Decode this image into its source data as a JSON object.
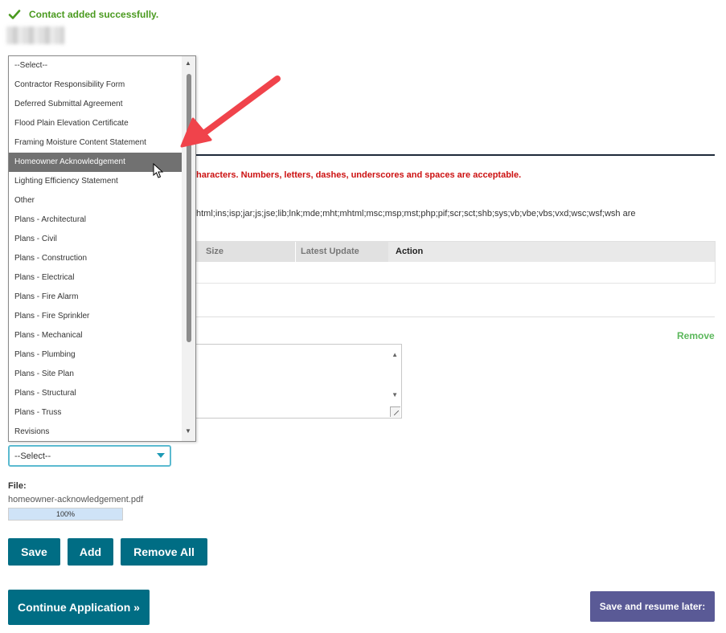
{
  "notification": {
    "message": "Contact added successfully.",
    "icon": "check-icon"
  },
  "warning": {
    "text": "haracters. Numbers, letters, dashes, underscores and spaces are acceptable."
  },
  "extensions": {
    "text": "html;ins;isp;jar;js;jse;lib;lnk;mde;mht;mhtml;msc;msp;mst;php;pif;scr;sct;shb;sys;vb;vbe;vbs;vxd;wsc;wsf;wsh are"
  },
  "table": {
    "columns": [
      "Size",
      "Latest Update",
      "Action"
    ]
  },
  "remove_link": "Remove",
  "dropdown": {
    "items": [
      "--Select--",
      "Contractor Responsibility Form",
      "Deferred Submittal Agreement",
      "Flood Plain Elevation Certificate",
      "Framing Moisture Content Statement",
      "Homeowner Acknowledgement",
      "Lighting Efficiency Statement",
      "Other",
      "Plans - Architectural",
      "Plans - Civil",
      "Plans - Construction",
      "Plans - Electrical",
      "Plans - Fire Alarm",
      "Plans - Fire Sprinkler",
      "Plans - Mechanical",
      "Plans - Plumbing",
      "Plans - Site Plan",
      "Plans - Structural",
      "Plans - Truss",
      "Revisions"
    ],
    "highlighted": "Homeowner Acknowledgement"
  },
  "type_select": {
    "value": "--Select--"
  },
  "file": {
    "label": "File:",
    "name": "homeowner-acknowledgement.pdf",
    "progress_text": "100%",
    "progress": 1.0
  },
  "buttons": {
    "save": "Save",
    "add": "Add",
    "remove_all": "Remove All",
    "continue": "Continue Application »",
    "save_later": "Save and resume later:"
  },
  "colors": {
    "primary_button": "#006d84",
    "secondary_button": "#5a5a96",
    "success": "#4a9a1f",
    "error": "#cc1111",
    "remove_link": "#5cb85c",
    "arrow": "#f0434b"
  }
}
